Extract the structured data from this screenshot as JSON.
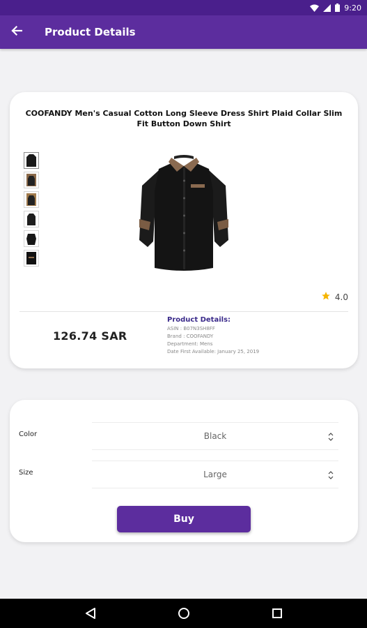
{
  "status_bar": {
    "time": "9:20"
  },
  "app_bar": {
    "title": "Product Details"
  },
  "product": {
    "title": "COOFANDY Men's Casual Cotton Long Sleeve Dress Shirt Plaid Collar Slim Fit Button Down Shirt",
    "rating": "4.0",
    "price": "126.74 SAR",
    "details_heading": "Product Details:",
    "details": [
      "ASIN : B07N3SH8FF",
      "Brand : COOFANDY",
      "Department: Mens",
      "Date First Available: January 25, 2019"
    ],
    "thumbnail_count": 6
  },
  "options": {
    "color_label": "Color",
    "color_value": "Black",
    "size_label": "Size",
    "size_value": "Large",
    "buy_label": "Buy"
  },
  "colors": {
    "primary": "#5c2d9e",
    "status": "#4a1f8c",
    "star": "#f5b400"
  }
}
